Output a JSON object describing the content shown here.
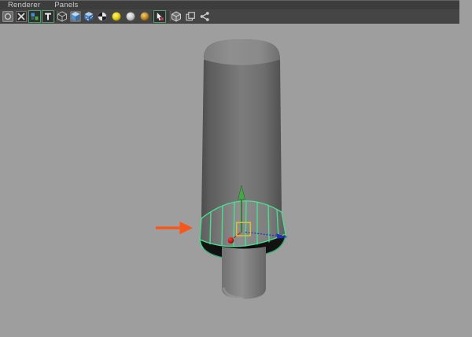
{
  "app": "3d-viewport-panel",
  "menubar": {
    "items": [
      {
        "label": "Renderer"
      },
      {
        "label": "Panels"
      }
    ]
  },
  "toolbar": {
    "buttons": [
      {
        "name": "select-camera",
        "active": false
      },
      {
        "name": "film-gate",
        "active": false
      },
      {
        "name": "resolution-gate",
        "active": true
      },
      {
        "name": "display-hud",
        "active": true
      },
      {
        "name": "wireframe-mode",
        "active": false
      },
      {
        "name": "shaded-mode",
        "active": true
      },
      {
        "name": "textured-mode",
        "active": false
      },
      {
        "name": "use-all-lights",
        "active": false
      },
      {
        "name": "default-lighting",
        "active": false
      },
      {
        "name": "flat-lighting",
        "active": false
      },
      {
        "name": "no-lights",
        "active": false
      },
      {
        "name": "isolate-select",
        "active": true
      },
      {
        "name": "xray-mode",
        "active": false
      },
      {
        "name": "xray-active-components",
        "active": false
      },
      {
        "name": "plugin-display-filter",
        "active": false
      }
    ]
  },
  "viewport": {
    "scene": "polygon cylinder with selected edge-loop band near bottom, move manipulator shown, orange annotation arrow pointing at selected band",
    "selected_component": "edge-loop band"
  },
  "colors": {
    "viewport_bg": "#9e9e9e",
    "selection_green": "#4ade91",
    "selection_green_dark": "#2fae6e",
    "annotation_orange": "#f7571a",
    "axis_x_red": "#b52a2a",
    "axis_y_green": "#2e7d32",
    "axis_y_head": "#46a546",
    "axis_z_blue": "#2a35c0",
    "axis_z_head": "#2330b8",
    "center_yellow": "#d2c437"
  }
}
